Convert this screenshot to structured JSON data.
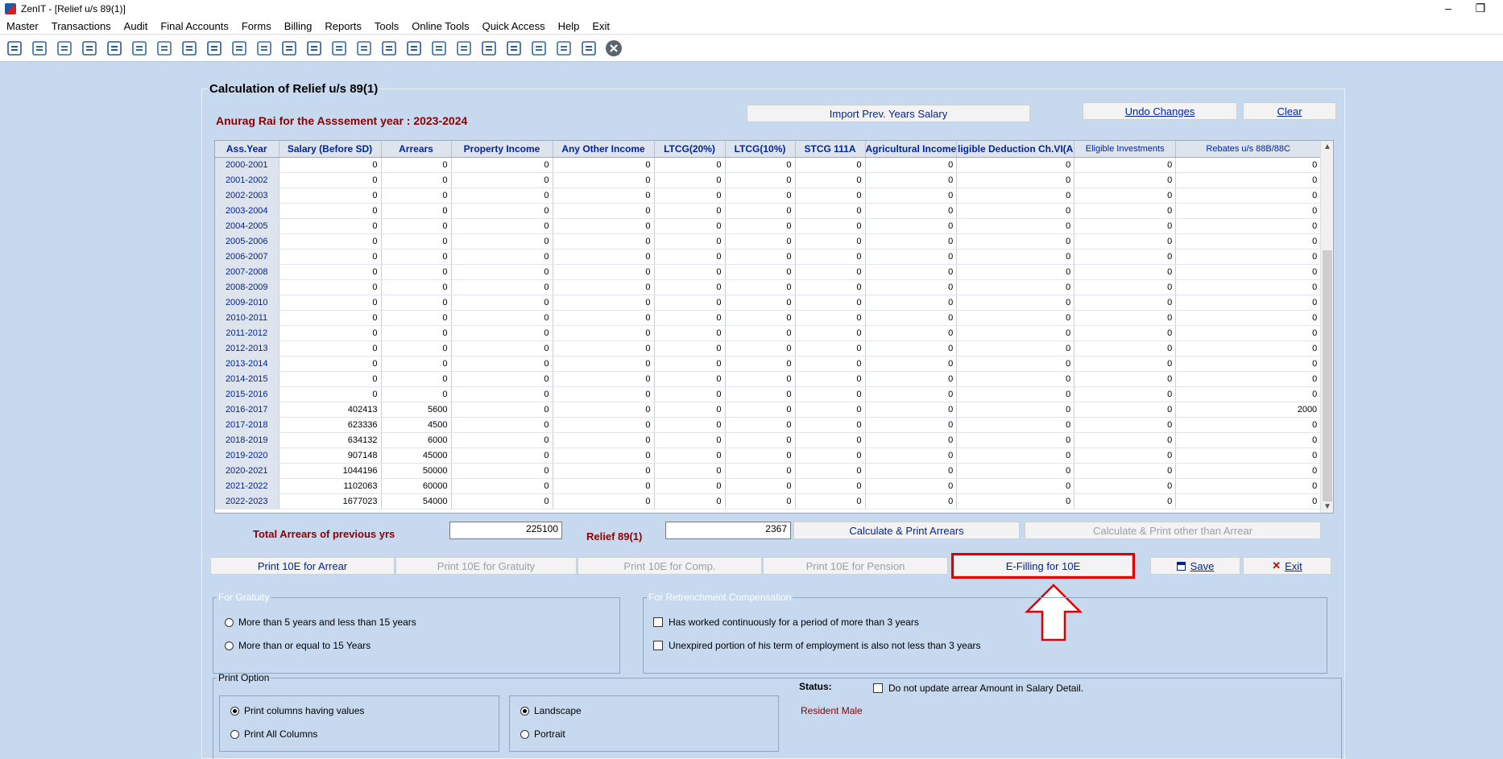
{
  "window": {
    "title": "ZenIT - [Relief u/s 89(1)]"
  },
  "menu": [
    "Master",
    "Transactions",
    "Audit",
    "Final Accounts",
    "Forms",
    "Billing",
    "Reports",
    "Tools",
    "Online Tools",
    "Quick Access",
    "Help",
    "Exit"
  ],
  "toolbar_icons": [
    "rupee-icon",
    "home-icon",
    "building-icon",
    "bar-chart-icon",
    "gift-icon",
    "users-icon",
    "pin-icon",
    "filter-icon",
    "tax-icon",
    "refresh-icon",
    "calculator-icon",
    "pie-chart-icon",
    "pay-icon",
    "book-icon",
    "info-icon",
    "document-icon",
    "form-icon",
    "calendar-icon",
    "add-icon",
    "search-doc-icon",
    "bs-icon",
    "bs-alt-icon",
    "3cd-icon",
    "report-icon",
    "close-icon"
  ],
  "form": {
    "title": "Calculation of Relief u/s 89(1)",
    "assessee": "Anurag Rai for the Asssement year : 2023-2024",
    "import_label": "Import Prev. Years Salary",
    "undo_label": "Undo Changes",
    "clear_label": "Clear"
  },
  "grid": {
    "columns": [
      "Ass.Year",
      "Salary (Before SD)",
      "Arrears",
      "Property Income",
      "Any Other Income",
      "LTCG(20%)",
      "LTCG(10%)",
      "STCG 111A",
      "Agricultural Income",
      "ligible Deduction Ch.VI(A",
      "Eligible Investments",
      "Rebates u/s 88B/88C"
    ],
    "rows": [
      [
        "2000-2001",
        "0",
        "0",
        "0",
        "0",
        "0",
        "0",
        "0",
        "0",
        "0",
        "0",
        "0"
      ],
      [
        "2001-2002",
        "0",
        "0",
        "0",
        "0",
        "0",
        "0",
        "0",
        "0",
        "0",
        "0",
        "0"
      ],
      [
        "2002-2003",
        "0",
        "0",
        "0",
        "0",
        "0",
        "0",
        "0",
        "0",
        "0",
        "0",
        "0"
      ],
      [
        "2003-2004",
        "0",
        "0",
        "0",
        "0",
        "0",
        "0",
        "0",
        "0",
        "0",
        "0",
        "0"
      ],
      [
        "2004-2005",
        "0",
        "0",
        "0",
        "0",
        "0",
        "0",
        "0",
        "0",
        "0",
        "0",
        "0"
      ],
      [
        "2005-2006",
        "0",
        "0",
        "0",
        "0",
        "0",
        "0",
        "0",
        "0",
        "0",
        "0",
        "0"
      ],
      [
        "2006-2007",
        "0",
        "0",
        "0",
        "0",
        "0",
        "0",
        "0",
        "0",
        "0",
        "0",
        "0"
      ],
      [
        "2007-2008",
        "0",
        "0",
        "0",
        "0",
        "0",
        "0",
        "0",
        "0",
        "0",
        "0",
        "0"
      ],
      [
        "2008-2009",
        "0",
        "0",
        "0",
        "0",
        "0",
        "0",
        "0",
        "0",
        "0",
        "0",
        "0"
      ],
      [
        "2009-2010",
        "0",
        "0",
        "0",
        "0",
        "0",
        "0",
        "0",
        "0",
        "0",
        "0",
        "0"
      ],
      [
        "2010-2011",
        "0",
        "0",
        "0",
        "0",
        "0",
        "0",
        "0",
        "0",
        "0",
        "0",
        "0"
      ],
      [
        "2011-2012",
        "0",
        "0",
        "0",
        "0",
        "0",
        "0",
        "0",
        "0",
        "0",
        "0",
        "0"
      ],
      [
        "2012-2013",
        "0",
        "0",
        "0",
        "0",
        "0",
        "0",
        "0",
        "0",
        "0",
        "0",
        "0"
      ],
      [
        "2013-2014",
        "0",
        "0",
        "0",
        "0",
        "0",
        "0",
        "0",
        "0",
        "0",
        "0",
        "0"
      ],
      [
        "2014-2015",
        "0",
        "0",
        "0",
        "0",
        "0",
        "0",
        "0",
        "0",
        "0",
        "0",
        "0"
      ],
      [
        "2015-2016",
        "0",
        "0",
        "0",
        "0",
        "0",
        "0",
        "0",
        "0",
        "0",
        "0",
        "0"
      ],
      [
        "2016-2017",
        "402413",
        "5600",
        "0",
        "0",
        "0",
        "0",
        "0",
        "0",
        "0",
        "0",
        "2000"
      ],
      [
        "2017-2018",
        "623336",
        "4500",
        "0",
        "0",
        "0",
        "0",
        "0",
        "0",
        "0",
        "0",
        "0"
      ],
      [
        "2018-2019",
        "634132",
        "6000",
        "0",
        "0",
        "0",
        "0",
        "0",
        "0",
        "0",
        "0",
        "0"
      ],
      [
        "2019-2020",
        "907148",
        "45000",
        "0",
        "0",
        "0",
        "0",
        "0",
        "0",
        "0",
        "0",
        "0"
      ],
      [
        "2020-2021",
        "1044196",
        "50000",
        "0",
        "0",
        "0",
        "0",
        "0",
        "0",
        "0",
        "0",
        "0"
      ],
      [
        "2021-2022",
        "1102063",
        "60000",
        "0",
        "0",
        "0",
        "0",
        "0",
        "0",
        "0",
        "0",
        "0"
      ],
      [
        "2022-2023",
        "1677023",
        "54000",
        "0",
        "0",
        "0",
        "0",
        "0",
        "0",
        "0",
        "0",
        "0"
      ]
    ]
  },
  "totals": {
    "arrears_label": "Total Arrears of previous yrs",
    "arrears_value": "225100",
    "relief_label": "Relief 89(1)",
    "relief_value": "2367",
    "calc_print_arrears": "Calculate & Print Arrears",
    "calc_print_other": "Calculate & Print other than Arrear"
  },
  "actions": {
    "print_arrear": "Print 10E for Arrear",
    "print_gratuity": "Print 10E for Gratuity",
    "print_comp": "Print 10E for Comp.",
    "print_pension": "Print 10E for Pension",
    "efiling": "E-Filling for 10E",
    "save": "Save",
    "exit": "Exit"
  },
  "gratuity": {
    "legend": "For Gratuity",
    "opt1": "More than 5 years and less than 15 years",
    "opt2": "More than or equal to 15 Years"
  },
  "retrenchment": {
    "legend": "For Retrenchment Compensation",
    "opt1": "Has worked continuously for a period of more than 3 years",
    "opt2": "Unexpired portion of his term of employment is also not less than 3 years"
  },
  "print_option": {
    "legend": "Print Option",
    "cols_values": "Print columns having values",
    "cols_all": "Print All Columns",
    "landscape": "Landscape",
    "portrait": "Portrait"
  },
  "status": {
    "label": "Status:",
    "no_update": "Do not update arrear Amount in Salary Detail.",
    "value": "Resident Male"
  }
}
